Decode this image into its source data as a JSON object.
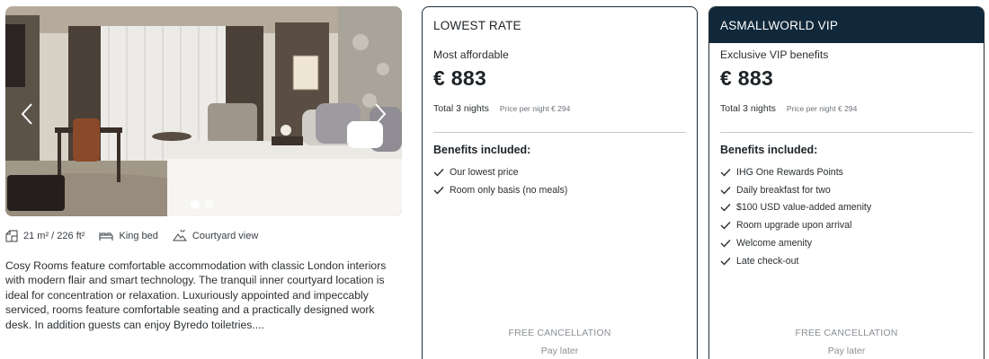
{
  "room": {
    "image_alt": "Cosy Room with king bed",
    "carousel": {
      "slide_count": 2,
      "active_slide": 1
    },
    "features": {
      "size": "21 m² / 226 ft²",
      "bed": "King bed",
      "view": "Courtyard view"
    },
    "description": "Cosy Rooms feature comfortable accommodation with classic London interiors with modern flair and smart technology. The tranquil inner courtyard location is ideal for concentration or relaxation. Luxuriously appointed and impeccably serviced, rooms feature comfortable seating and a practically designed work desk. In addition guests can enjoy Byredo toiletries...."
  },
  "rates": [
    {
      "header": "LOWEST RATE",
      "subtitle": "Most affordable",
      "price": "€ 883",
      "total": "Total 3 nights",
      "per_night": "Price per night € 294",
      "benefits_title": "Benefits included:",
      "benefits": [
        "Our lowest price",
        "Room only basis (no meals)"
      ],
      "free_cancellation": "FREE CANCELLATION",
      "pay_later": "Pay later"
    },
    {
      "header": "ASMALLWORLD VIP",
      "subtitle": "Exclusive VIP benefits",
      "price": "€ 883",
      "total": "Total 3 nights",
      "per_night": "Price per night € 294",
      "benefits_title": "Benefits included:",
      "benefits": [
        "IHG One Rewards Points",
        "Daily breakfast for two",
        "$100 USD value-added amenity",
        "Room upgrade upon arrival",
        "Welcome amenity",
        "Late check-out"
      ],
      "free_cancellation": "FREE CANCELLATION",
      "pay_later": "Pay later"
    }
  ],
  "colors": {
    "vip_header_bg": "#11283a",
    "card_border": "#1d2c36",
    "muted_text": "#8a8f94"
  },
  "icons": {
    "size": "floorplan-icon",
    "bed": "bed-icon",
    "view": "courtyard-view-icon",
    "benefit": "check-icon",
    "prev": "chevron-left-icon",
    "next": "chevron-right-icon"
  }
}
